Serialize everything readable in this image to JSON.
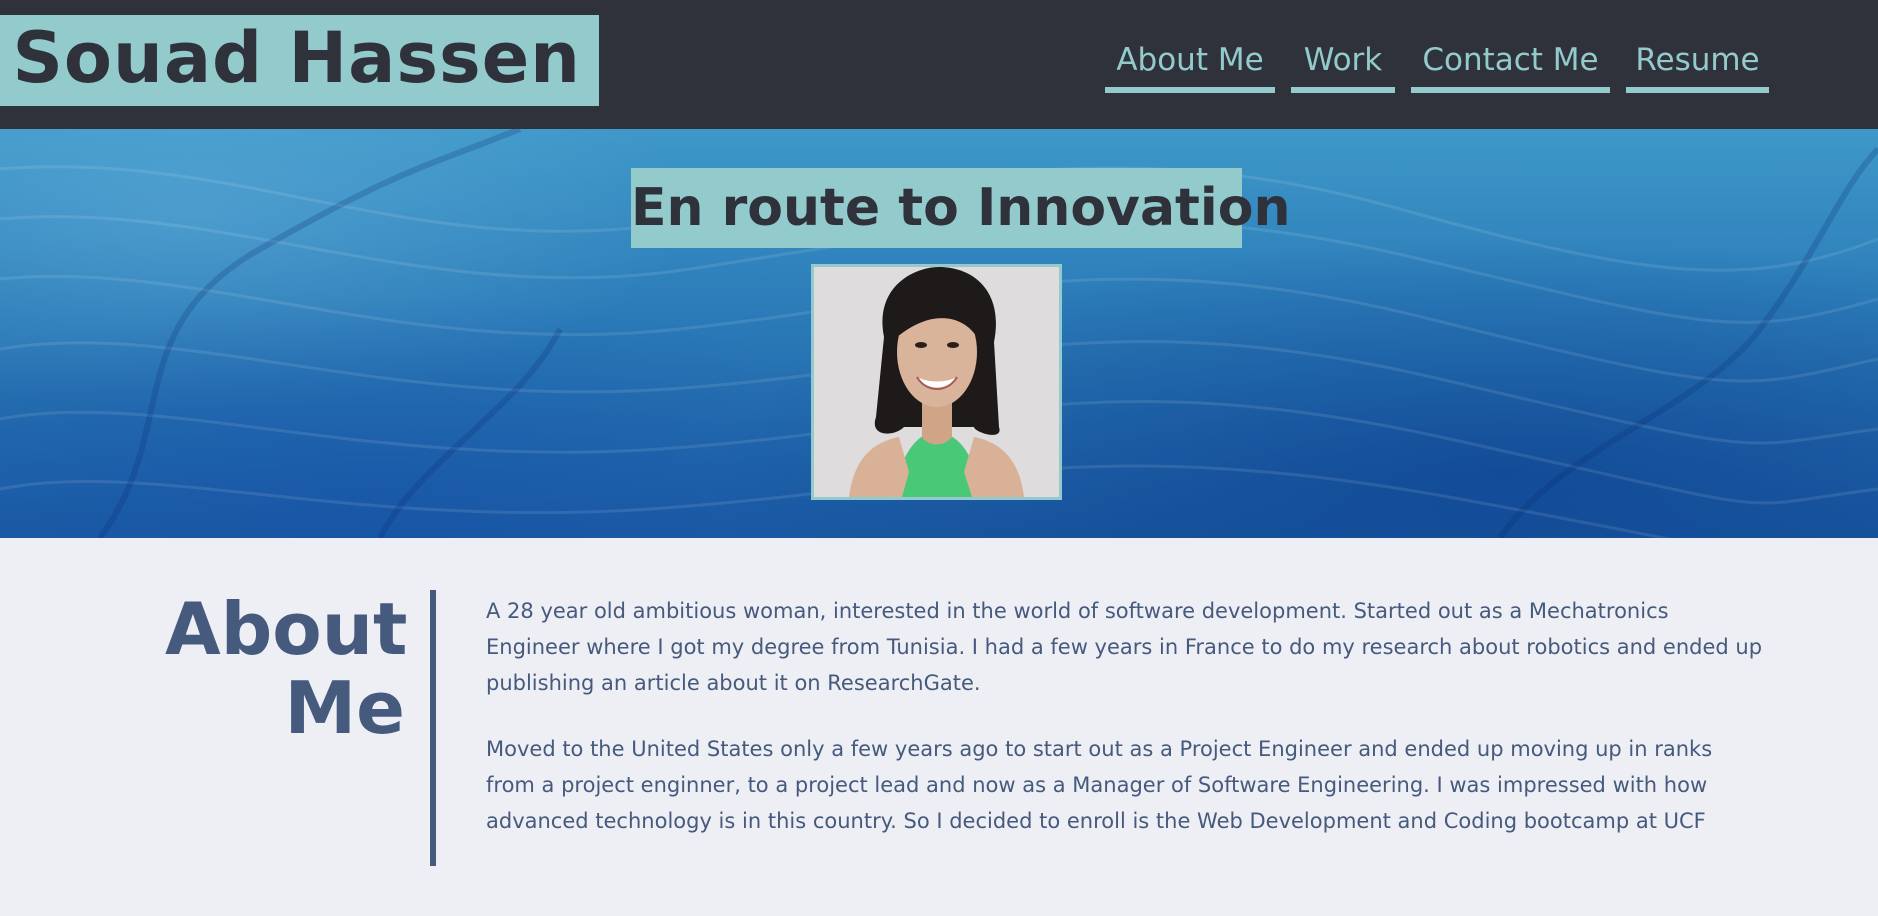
{
  "header": {
    "brand_name": "Souad Hassen",
    "nav": [
      {
        "label": "About Me"
      },
      {
        "label": "Work"
      },
      {
        "label": "Contact Me"
      },
      {
        "label": "Resume"
      }
    ]
  },
  "hero": {
    "title": "En route to Innovation",
    "stock_image_id": "#308935471"
  },
  "about": {
    "heading_line1": "About",
    "heading_line2": "Me",
    "paragraphs": [
      "A 28 year old ambitious woman, interested in the world of software development. Started out as a Mechatronics Engineer where I got my degree from Tunisia. I had a few years in France to do my research about robotics and ended up publishing an article about it on ResearchGate.",
      "Moved to the United States only a few years ago to start out as a Project Engineer and ended up moving up in ranks from a project enginner, to a project lead and now as a Manager of Software Engineering. I was impressed with how advanced technology is in this country. So I decided to enroll is the Web Development and Coding bootcamp at UCF"
    ]
  },
  "colors": {
    "header_bg": "#30323b",
    "accent": "#93cbcd",
    "text": "#455a7d",
    "page_bg": "#eeeef5",
    "shirt": "#49c878"
  }
}
